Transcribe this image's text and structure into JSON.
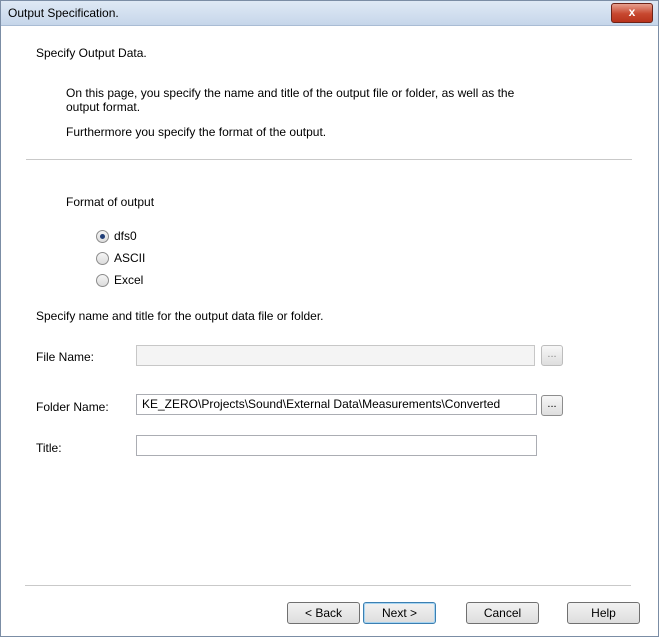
{
  "window": {
    "title": "Output Specification.",
    "close_label": "x"
  },
  "header": {
    "heading": "Specify Output Data.",
    "desc_line1": "On this page,  you specify the name and title of the output file or folder, as well as the",
    "desc_line2": "output format.",
    "desc_line3": "Furthermore you specify the format of  the output."
  },
  "format": {
    "label": "Format of output",
    "options": [
      {
        "label": "dfs0",
        "checked": true
      },
      {
        "label": "ASCII",
        "checked": false
      },
      {
        "label": "Excel",
        "checked": false
      }
    ]
  },
  "output": {
    "instruction": "Specify name and title for the output data file or folder.",
    "file_name_label": "File Name:",
    "file_name_value": "",
    "folder_name_label": "Folder Name:",
    "folder_name_value": "KE_ZERO\\Projects\\Sound\\External Data\\Measurements\\Converted",
    "title_label": "Title:",
    "title_value": "",
    "browse_label": "..."
  },
  "buttons": {
    "back": "< Back",
    "next": "Next >",
    "cancel": "Cancel",
    "help": "Help"
  }
}
